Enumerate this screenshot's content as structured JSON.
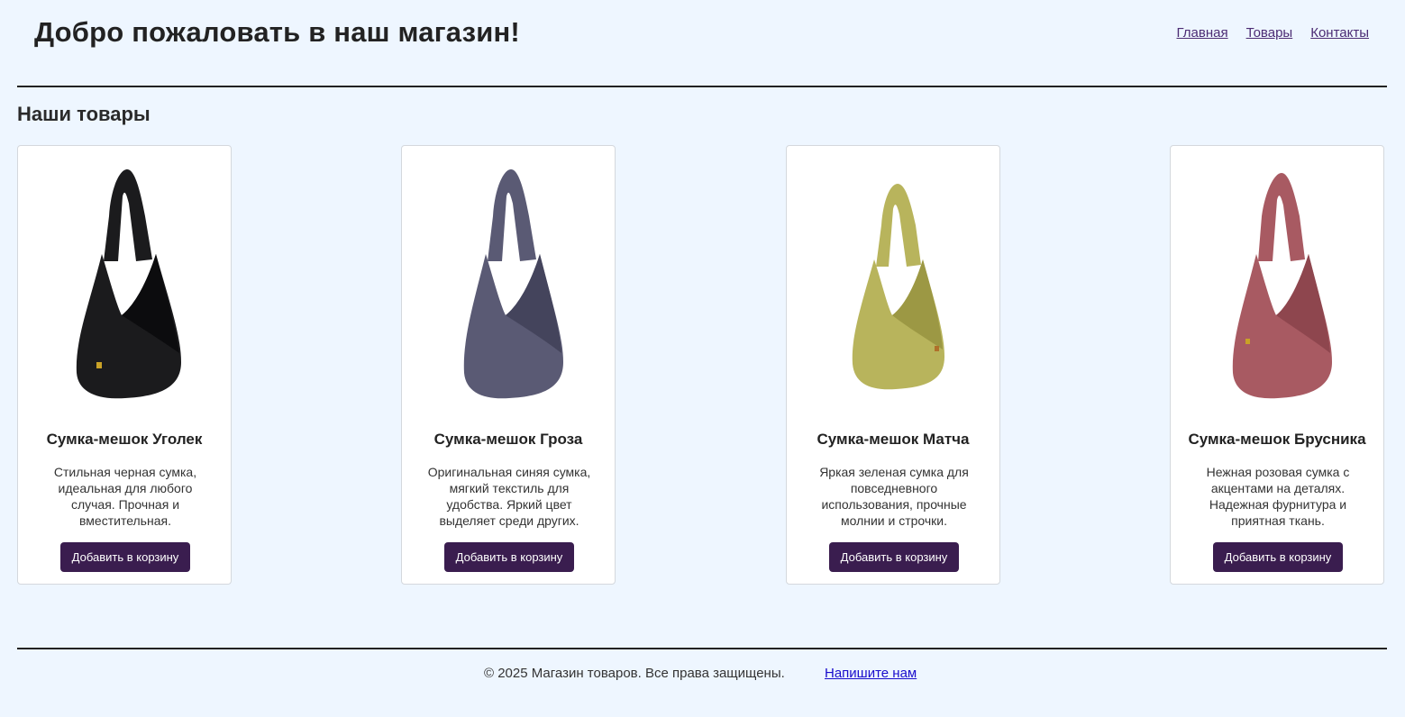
{
  "header": {
    "title": "Добро пожаловать в наш магазин!",
    "nav": [
      {
        "label": "Главная"
      },
      {
        "label": "Товары"
      },
      {
        "label": "Контакты"
      }
    ]
  },
  "main": {
    "section_title": "Наши товары",
    "products": [
      {
        "name": "Сумка-мешок Уголек",
        "description": "Стильная черная сумка, идеальная для любого случая. Прочная и вместительная.",
        "button_label": "Добавить в корзину",
        "bag_color": "#1b1b1d",
        "bag_shade": "#0c0c0e"
      },
      {
        "name": "Сумка-мешок Гроза",
        "description": "Оригинальная синяя сумка, мягкий текстиль для удобства. Яркий цвет выделяет среди других.",
        "button_label": "Добавить в корзину",
        "bag_color": "#5a5a74",
        "bag_shade": "#44445c"
      },
      {
        "name": "Сумка-мешок Матча",
        "description": "Яркая зеленая сумка для повседневного использования, прочные молнии и строчки.",
        "button_label": "Добавить в корзину",
        "bag_color": "#b8b45c",
        "bag_shade": "#9c9844"
      },
      {
        "name": "Сумка-мешок Брусника",
        "description": "Нежная розовая сумка с акцентами на деталях. Надежная фурнитура и приятная ткань.",
        "button_label": "Добавить в корзину",
        "bag_color": "#a85a62",
        "bag_shade": "#8e464e"
      }
    ]
  },
  "footer": {
    "copyright": "© 2025 Магазин товаров. Все права защищены.",
    "contact_link": "Напишите нам"
  },
  "colors": {
    "background": "#eef6ff",
    "button": "#3a1d4f",
    "nav_link": "#4b2b73",
    "footer_link": "#1a0dcc"
  }
}
